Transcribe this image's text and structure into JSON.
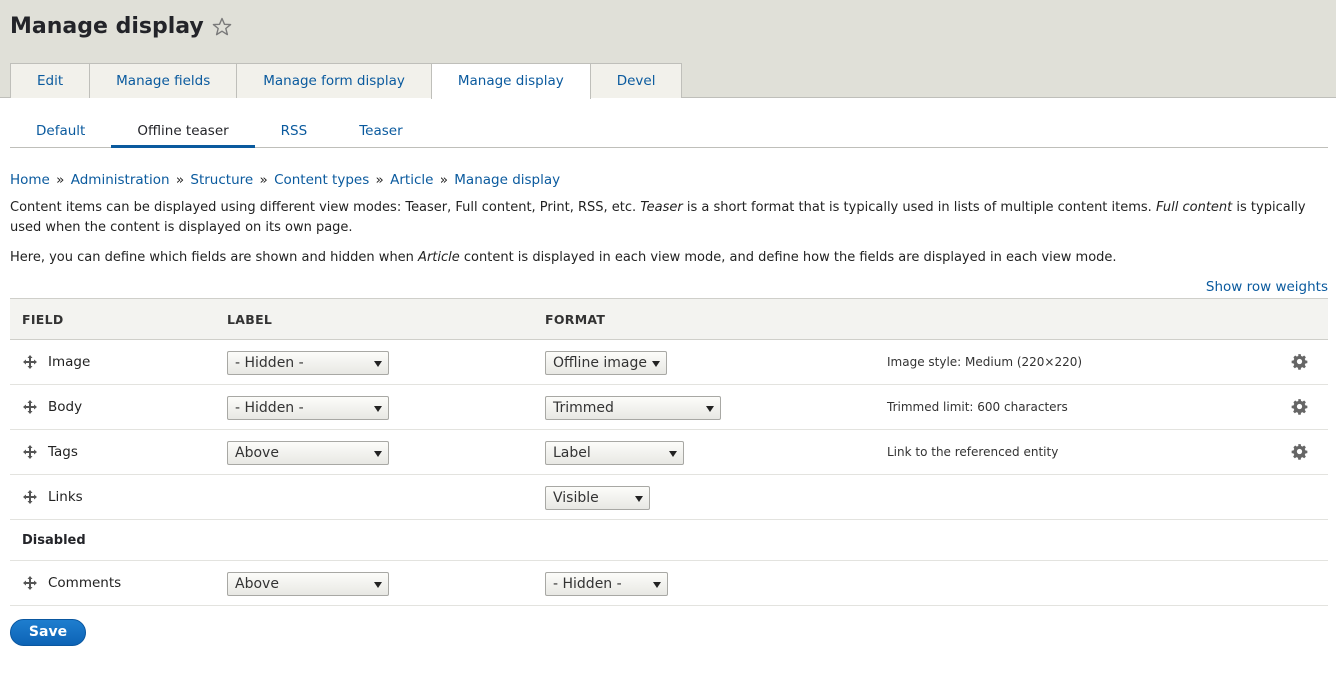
{
  "header": {
    "title": "Manage display"
  },
  "tabs": [
    {
      "label": "Edit"
    },
    {
      "label": "Manage fields"
    },
    {
      "label": "Manage form display"
    },
    {
      "label": "Manage display",
      "active": true
    },
    {
      "label": "Devel"
    }
  ],
  "subtabs": [
    {
      "label": "Default"
    },
    {
      "label": "Offline teaser",
      "active": true
    },
    {
      "label": "RSS"
    },
    {
      "label": "Teaser"
    }
  ],
  "breadcrumb": [
    "Home",
    "Administration",
    "Structure",
    "Content types",
    "Article",
    "Manage display"
  ],
  "breadcrumb_separator": "»",
  "description": {
    "p1_a": "Content items can be displayed using different view modes: Teaser, Full content, Print, RSS, etc. ",
    "p1_b": "Teaser",
    "p1_c": " is a short format that is typically used in lists of multiple content items. ",
    "p1_d": "Full content",
    "p1_e": " is typically used when the content is displayed on its own page.",
    "p2_a": "Here, you can define which fields are shown and hidden when ",
    "p2_b": "Article",
    "p2_c": " content is displayed in each view mode, and define how the fields are displayed in each view mode."
  },
  "show_row_weights": "Show row weights",
  "table": {
    "headers": {
      "field": "FIELD",
      "label": "LABEL",
      "format": "FORMAT"
    },
    "rows": [
      {
        "field": "Image",
        "label": "- Hidden -",
        "format": "Offline image",
        "summary": "Image style: Medium (220×220)"
      },
      {
        "field": "Body",
        "label": "- Hidden -",
        "format": "Trimmed",
        "summary": "Trimmed limit: 600 characters"
      },
      {
        "field": "Tags",
        "label": "Above",
        "format": "Label",
        "summary": "Link to the referenced entity"
      },
      {
        "field": "Links",
        "format": "Visible"
      }
    ],
    "disabled_label": "Disabled",
    "disabled_rows": [
      {
        "field": "Comments",
        "label": "Above",
        "format": "- Hidden -"
      }
    ]
  },
  "save_label": "Save"
}
